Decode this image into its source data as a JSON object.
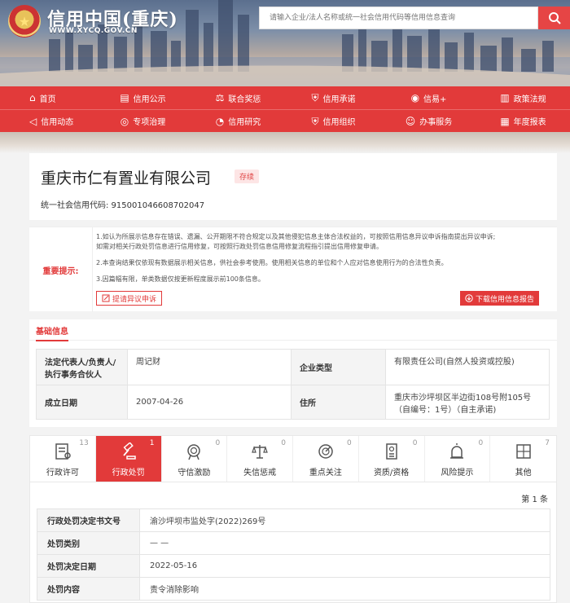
{
  "header": {
    "site_title": "信用中国(重庆)",
    "site_url": "WWW.XYCQ.GOV.CN",
    "search_placeholder": "请输入企业/法人名称或统一社会信用代码等信用信息查询"
  },
  "nav": {
    "row1": [
      {
        "label": "首页",
        "icon": "home-icon"
      },
      {
        "label": "信用公示",
        "icon": "document-icon"
      },
      {
        "label": "联合奖惩",
        "icon": "scale-icon"
      },
      {
        "label": "信用承诺",
        "icon": "shield-icon"
      },
      {
        "label": "信易+",
        "icon": "pin-icon"
      },
      {
        "label": "政策法规",
        "icon": "book-icon"
      }
    ],
    "row2": [
      {
        "label": "信用动态",
        "icon": "speaker-icon"
      },
      {
        "label": "专项治理",
        "icon": "target-icon"
      },
      {
        "label": "信用研究",
        "icon": "chart-icon"
      },
      {
        "label": "信用组织",
        "icon": "group-icon"
      },
      {
        "label": "办事服务",
        "icon": "user-icon"
      },
      {
        "label": "年度报表",
        "icon": "report-icon"
      }
    ]
  },
  "company": {
    "name": "重庆市仁有置业有限公司",
    "status": "存续",
    "credit_code": "统一社会信用代码: 915001046608702047"
  },
  "notice": {
    "label": "重要提示:",
    "line1a": "1.如认为所展示信息存在错误、遗漏、公开期限不符合规定以及其他侵犯信息主体合法权益的，可按照信用信息异议申诉指南提出异议申诉;",
    "line1b": "如需对相关行政处罚信息进行信用修复，可按照行政处罚信息信用修复流程指引提出信用修复申请。",
    "line2": "2.本查询结果仅依现有数据展示相关信息，供社会参考使用。使用相关信息的单位和个人应对信息使用行为的合法性负责。",
    "line3": "3.因篇幅有限，单类数据仅按更新程度展示前100条信息。",
    "objection_btn": "提请异议申诉",
    "download_btn": "下载信用信息报告"
  },
  "basic_info": {
    "title": "基础信息",
    "legal_rep_label": "法定代表人/负责人/执行事务合伙人",
    "legal_rep_value": "周记财",
    "type_label": "企业类型",
    "type_value": "有限责任公司(自然人投资或控股)",
    "date_label": "成立日期",
    "date_value": "2007-04-26",
    "address_label": "住所",
    "address_value": "重庆市沙坪坝区半边街108号附105号（自编号：1号）（自主承诺)"
  },
  "tabs": [
    {
      "label": "行政许可",
      "count": "13",
      "icon": "license-icon"
    },
    {
      "label": "行政处罚",
      "count": "1",
      "icon": "gavel-icon"
    },
    {
      "label": "守信激励",
      "count": "0",
      "icon": "medal-icon"
    },
    {
      "label": "失信惩戒",
      "count": "0",
      "icon": "scales-icon"
    },
    {
      "label": "重点关注",
      "count": "0",
      "icon": "radar-icon"
    },
    {
      "label": "资质/资格",
      "count": "0",
      "icon": "certificate-icon"
    },
    {
      "label": "风险提示",
      "count": "0",
      "icon": "alarm-icon"
    },
    {
      "label": "其他",
      "count": "7",
      "icon": "apps-icon"
    }
  ],
  "records": {
    "count_text": "第 1 条",
    "rows": [
      {
        "label": "行政处罚决定书文号",
        "value": "渝沙坪坝市监处字(2022)269号"
      },
      {
        "label": "处罚类别",
        "value": "— —"
      },
      {
        "label": "处罚决定日期",
        "value": "2022-05-16"
      },
      {
        "label": "处罚内容",
        "value": "责令消除影响"
      }
    ]
  },
  "colors": {
    "accent": "#e23a3a",
    "tag_bg": "#fde5e5"
  }
}
